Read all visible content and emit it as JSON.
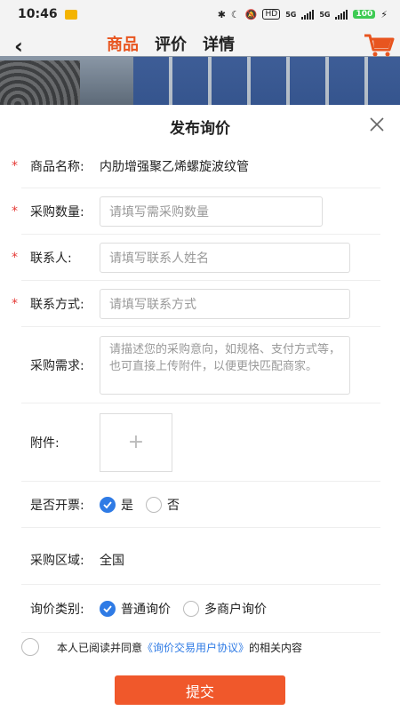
{
  "status": {
    "time": "10:46",
    "hd": "HD",
    "net1": "5G",
    "net2": "5G",
    "battery": "100"
  },
  "header": {
    "back_icon": "chevron-left-icon",
    "tabs": [
      {
        "label": "商品",
        "active": true
      },
      {
        "label": "评价",
        "active": false
      },
      {
        "label": "详情",
        "active": false
      }
    ],
    "cart_icon": "cart-icon"
  },
  "sheet": {
    "title": "发布询价",
    "close_icon": "close-icon",
    "fields": {
      "product": {
        "label": "商品名称:",
        "value": "内肋增强聚乙烯螺旋波纹管"
      },
      "quantity": {
        "label": "采购数量:",
        "placeholder": "请填写需采购数量"
      },
      "contact": {
        "label": "联系人:",
        "placeholder": "请填写联系人姓名"
      },
      "method": {
        "label": "联系方式:",
        "placeholder": "请填写联系方式"
      },
      "demand": {
        "label": "采购需求:",
        "placeholder": "请描述您的采购意向，如规格、支付方式等，也可直接上传附件，以便更快匹配商家。"
      },
      "attachment": {
        "label": "附件:",
        "plus": "+"
      },
      "invoice": {
        "label": "是否开票:",
        "options": [
          {
            "label": "是",
            "selected": true
          },
          {
            "label": "否",
            "selected": false
          }
        ]
      },
      "region": {
        "label": "采购区域:",
        "value": "全国"
      },
      "type": {
        "label": "询价类别:",
        "options": [
          {
            "label": "普通询价",
            "selected": true
          },
          {
            "label": "多商户询价",
            "selected": false
          }
        ]
      }
    },
    "agreement": {
      "checked": false,
      "prefix": "本人已阅读并同意",
      "link": "《询价交易用户协议》",
      "suffix": "的相关内容"
    },
    "submit_label": "提交"
  },
  "colors": {
    "accent": "#e8551f",
    "submit": "#f0582b",
    "radio_on": "#2f7be5",
    "required": "#e53935"
  }
}
